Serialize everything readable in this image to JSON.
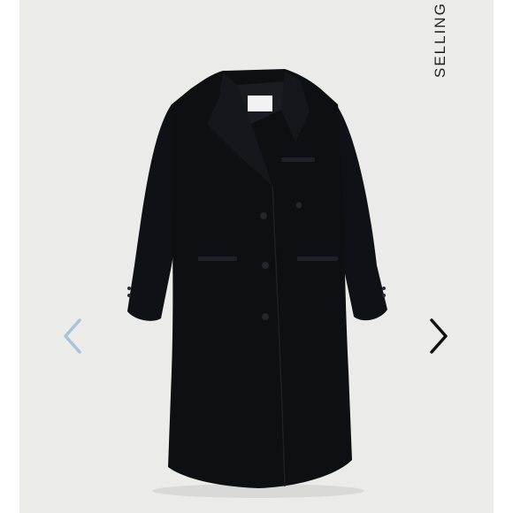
{
  "gallery": {
    "side_label": "SELLING",
    "prev_icon": "chevron-left-icon",
    "next_icon": "chevron-right-icon",
    "colors": {
      "background": "#ffffff",
      "photo_background": "#ebebea",
      "coat": "#0e0f13",
      "prev_arrow": "#a9c4d8",
      "next_arrow": "#111111"
    }
  }
}
